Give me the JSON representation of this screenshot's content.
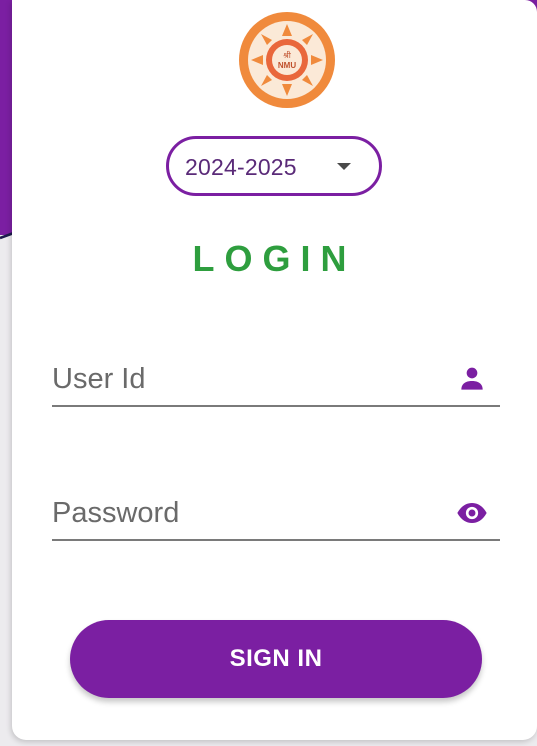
{
  "logo": {
    "icon": "university-emblem-icon",
    "emblem_text": "श्री",
    "abbr": "NMU",
    "colors": {
      "orange": "#f08a3c",
      "cream": "#fbe9d7"
    }
  },
  "year_selector": {
    "selected": "2024-2025",
    "caret_icon": "caret-down-icon"
  },
  "login": {
    "title": "LOGIN",
    "title_color": "#2e9e3e",
    "user_id": {
      "placeholder": "User Id",
      "value": "",
      "icon": "person-icon"
    },
    "password": {
      "placeholder": "Password",
      "value": "",
      "icon": "eye-icon"
    },
    "submit_label": "SIGN IN"
  },
  "theme": {
    "primary": "#7b1fa2",
    "arrow_color": "#1c1b4d"
  }
}
